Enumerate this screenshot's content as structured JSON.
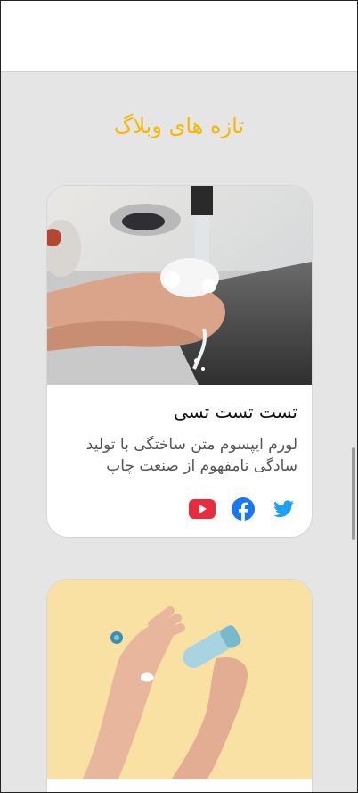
{
  "section": {
    "title": "تازه های وبلاگ"
  },
  "posts": [
    {
      "title": "تست تست تسی",
      "excerpt": "لورم ایپسوم متن ساختگی با تولید سادگی نامفهوم از صنعت چاپ",
      "image": "hand-washing-photo",
      "social": [
        "twitter-icon",
        "facebook-icon",
        "youtube-icon"
      ]
    },
    {
      "image": "hand-cream-photo"
    }
  ],
  "colors": {
    "accent": "#f6b800",
    "twitter": "#1da1f2",
    "facebook": "#1877f2",
    "youtube": "#e62c3d"
  }
}
